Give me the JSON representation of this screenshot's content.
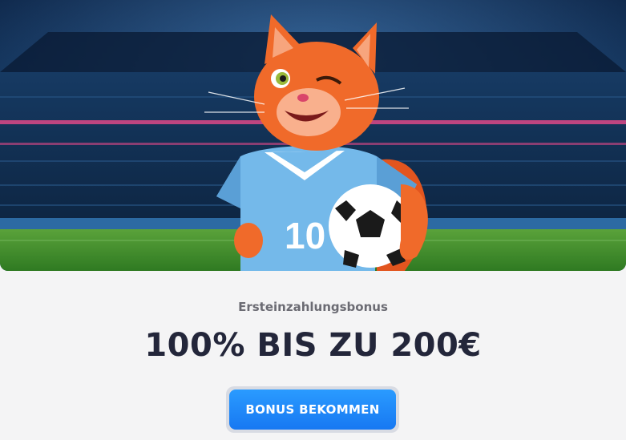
{
  "banner": {
    "jersey_number": "10",
    "colors": {
      "sky": "#0e2a4e",
      "pitch": "#3d8d2e",
      "cat_fur": "#f06a2a",
      "jersey": "#74b9ea"
    },
    "icon": "cat-football-player-illustration"
  },
  "offer": {
    "subtitle": "Ersteinzahlungsbonus",
    "headline": "100% BIS ZU 200€",
    "cta_label": "BONUS BEKOMMEN"
  },
  "colors": {
    "cta": "#1f8bf7",
    "headline": "#23263a",
    "subtitle": "#6b6b73"
  }
}
